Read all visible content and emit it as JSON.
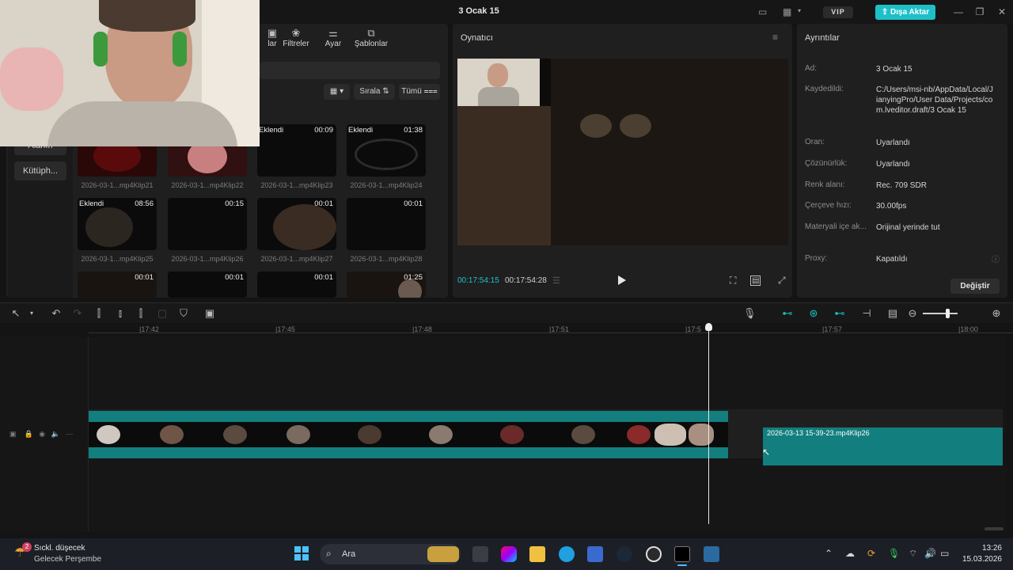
{
  "app": {
    "title": "3 Ocak 15",
    "vip_label": "VIP",
    "export_label": "Dışa Aktar"
  },
  "toolbar_tabs": [
    {
      "label": "lar",
      "icon": "text-icon"
    },
    {
      "label": "Filtreler",
      "icon": "filters-icon"
    },
    {
      "label": "Ayar",
      "icon": "adjust-icon"
    },
    {
      "label": "Şablonlar",
      "icon": "templates-icon"
    }
  ],
  "side_nav": {
    "partial_label": "Alanın",
    "library_label": "Kütüph..."
  },
  "media": {
    "sort_label": "Sırala",
    "filter_label": "Tümü",
    "clips": [
      {
        "name": "2026-03-1...mp4Klip21",
        "added": "",
        "duration": ""
      },
      {
        "name": "2026-03-1...mp4Klip22",
        "added": "",
        "duration": ""
      },
      {
        "name": "2026-03-1...mp4Klip23",
        "added": "Eklendi",
        "duration": "00:09"
      },
      {
        "name": "2026-03-1...mp4Klip24",
        "added": "Eklendi",
        "duration": "01:38"
      },
      {
        "name": "2026-03-1...mp4Klip25",
        "added": "Eklendi",
        "duration": "08:56"
      },
      {
        "name": "2026-03-1...mp4Klip26",
        "added": "",
        "duration": "00:15"
      },
      {
        "name": "2026-03-1...mp4Klip27",
        "added": "",
        "duration": "00:01"
      },
      {
        "name": "2026-03-1...mp4Klip28",
        "added": "",
        "duration": "00:01"
      },
      {
        "name": "",
        "added": "",
        "duration": "00:01"
      },
      {
        "name": "",
        "added": "",
        "duration": "00:01"
      },
      {
        "name": "",
        "added": "",
        "duration": "00:01"
      },
      {
        "name": "",
        "added": "",
        "duration": "01:25"
      }
    ]
  },
  "player": {
    "title": "Oynatıcı",
    "current_time": "00:17:54:15",
    "total_time": "00:17:54:28"
  },
  "details": {
    "title": "Ayrıntılar",
    "rows": [
      {
        "label": "Ad:",
        "value": "3 Ocak 15"
      },
      {
        "label": "Kaydedildi:",
        "value": "C:/Users/msi-nb/AppData/Local/JianyingPro/User Data/Projects/com.lveditor.draft/3 Ocak 15"
      },
      {
        "label": "Oran:",
        "value": "Uyarlandı"
      },
      {
        "label": "Çözünürlük:",
        "value": "Uyarlandı"
      },
      {
        "label": "Renk alanı:",
        "value": "Rec. 709 SDR"
      },
      {
        "label": "Çerçeve hızı:",
        "value": "30.00fps"
      },
      {
        "label": "Materyali içe ak...",
        "value": "Orijinal yerinde tut"
      },
      {
        "label": "Proxy:",
        "value": "Kapatıldı"
      }
    ],
    "change_label": "Değiştir"
  },
  "timeline": {
    "ticks": [
      "|17:42",
      "|17:45",
      "|17:48",
      "|17:51",
      "|17:5",
      "|17:57",
      "|18:00"
    ],
    "drag_clip_label": "2026-03-13 15-39-23.mp4Klip26",
    "zoom_level": 0.7
  },
  "taskbar": {
    "weather_title": "Sıckl. düşecek",
    "weather_sub": "Gelecek Perşembe",
    "notification_count": "2",
    "search_placeholder": "Ara",
    "time": "13:26",
    "date": "15.03.2026"
  },
  "colors": {
    "accent": "#1ec0c8",
    "clip": "#137e7e"
  }
}
